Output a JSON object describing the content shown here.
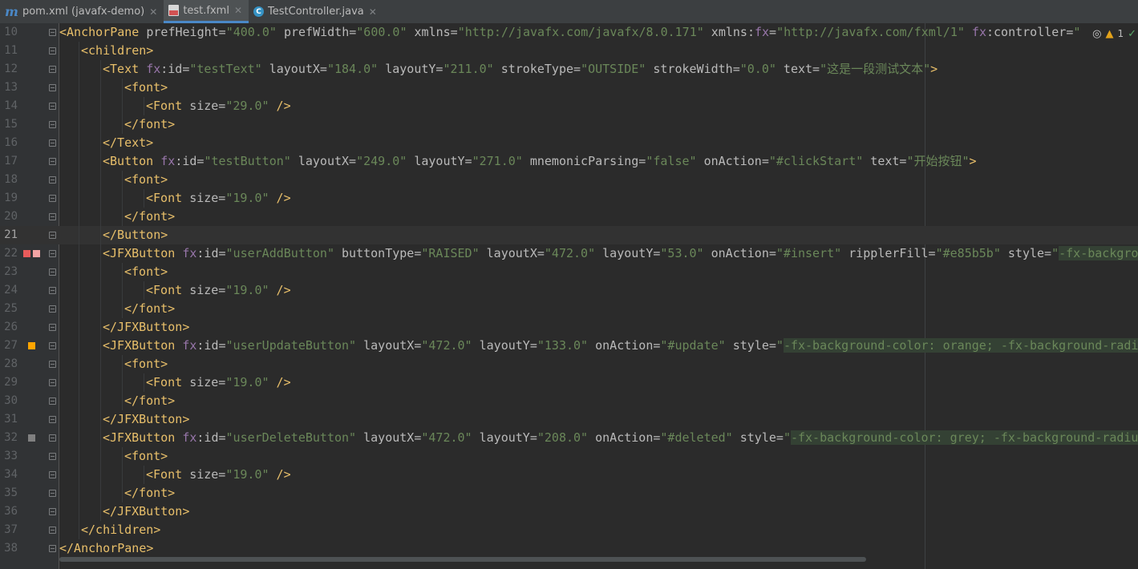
{
  "tabs": [
    {
      "label": "pom.xml (javafx-demo)",
      "icon": "maven-icon",
      "active": false
    },
    {
      "label": "test.fxml",
      "icon": "fxml-file-icon",
      "active": true
    },
    {
      "label": "TestController.java",
      "icon": "java-class-icon",
      "active": false
    }
  ],
  "close_glyph": "✕",
  "inspections": {
    "warning_count": "1"
  },
  "current_line": "21",
  "swatch_colors": {
    "line22": [
      "#e85b5b",
      "#f4a4a4"
    ],
    "line27": "#ffa500",
    "line32": "#808080"
  },
  "lines": [
    {
      "num": "10",
      "indent": 0,
      "tokens": [
        [
          "tag",
          "<AnchorPane "
        ],
        [
          "attr",
          "prefHeight="
        ],
        [
          "val",
          "\"400.0\""
        ],
        [
          "attr",
          " prefWidth="
        ],
        [
          "val",
          "\"600.0\""
        ],
        [
          "attr",
          " xmlns="
        ],
        [
          "val",
          "\"http://javafx.com/javafx/8.0.171\""
        ],
        [
          "attr",
          " xmlns:"
        ],
        [
          "ns",
          "fx"
        ],
        [
          "attr",
          "="
        ],
        [
          "val",
          "\"http://javafx.com/fxml/1\""
        ],
        [
          "ns",
          " fx"
        ],
        [
          "attr",
          ":controller="
        ],
        [
          "val",
          "\""
        ]
      ]
    },
    {
      "num": "11",
      "indent": 1,
      "tokens": [
        [
          "tag",
          "<children>"
        ]
      ]
    },
    {
      "num": "12",
      "indent": 2,
      "tokens": [
        [
          "tag",
          "<Text "
        ],
        [
          "ns",
          "fx"
        ],
        [
          "attr",
          ":id="
        ],
        [
          "val",
          "\"testText\""
        ],
        [
          "attr",
          " layoutX="
        ],
        [
          "val",
          "\"184.0\""
        ],
        [
          "attr",
          " layoutY="
        ],
        [
          "val",
          "\"211.0\""
        ],
        [
          "attr",
          " strokeType="
        ],
        [
          "val",
          "\"OUTSIDE\""
        ],
        [
          "attr",
          " strokeWidth="
        ],
        [
          "val",
          "\"0.0\""
        ],
        [
          "attr",
          " text="
        ],
        [
          "val",
          "\"这是一段测试文本\""
        ],
        [
          "tag",
          ">"
        ]
      ]
    },
    {
      "num": "13",
      "indent": 3,
      "tokens": [
        [
          "tag",
          "<font>"
        ]
      ]
    },
    {
      "num": "14",
      "indent": 4,
      "tokens": [
        [
          "tag",
          "<Font "
        ],
        [
          "attr",
          "size="
        ],
        [
          "val",
          "\"29.0\""
        ],
        [
          "tag",
          " />"
        ]
      ]
    },
    {
      "num": "15",
      "indent": 3,
      "tokens": [
        [
          "tag",
          "</font>"
        ]
      ]
    },
    {
      "num": "16",
      "indent": 2,
      "tokens": [
        [
          "tag",
          "</Text>"
        ]
      ]
    },
    {
      "num": "17",
      "indent": 2,
      "tokens": [
        [
          "tag",
          "<Button "
        ],
        [
          "ns",
          "fx"
        ],
        [
          "attr",
          ":id="
        ],
        [
          "val",
          "\"testButton\""
        ],
        [
          "attr",
          " layoutX="
        ],
        [
          "val",
          "\"249.0\""
        ],
        [
          "attr",
          " layoutY="
        ],
        [
          "val",
          "\"271.0\""
        ],
        [
          "attr",
          " mnemonicParsing="
        ],
        [
          "val",
          "\"false\""
        ],
        [
          "attr",
          " onAction="
        ],
        [
          "val",
          "\"#clickStart\""
        ],
        [
          "attr",
          " text="
        ],
        [
          "val",
          "\"开始按钮\""
        ],
        [
          "tag",
          ">"
        ]
      ]
    },
    {
      "num": "18",
      "indent": 3,
      "tokens": [
        [
          "tag",
          "<font>"
        ]
      ]
    },
    {
      "num": "19",
      "indent": 4,
      "tokens": [
        [
          "tag",
          "<Font "
        ],
        [
          "attr",
          "size="
        ],
        [
          "val",
          "\"19.0\""
        ],
        [
          "tag",
          " />"
        ]
      ]
    },
    {
      "num": "20",
      "indent": 3,
      "tokens": [
        [
          "tag",
          "</font>"
        ]
      ]
    },
    {
      "num": "21",
      "indent": 2,
      "tokens": [
        [
          "tag",
          "</Button>"
        ]
      ]
    },
    {
      "num": "22",
      "indent": 2,
      "tokens": [
        [
          "tag",
          "<JFXButton "
        ],
        [
          "ns",
          "fx"
        ],
        [
          "attr",
          ":id="
        ],
        [
          "val",
          "\"userAddButton\""
        ],
        [
          "attr",
          " buttonType="
        ],
        [
          "val",
          "\"RAISED\""
        ],
        [
          "attr",
          " layoutX="
        ],
        [
          "val",
          "\"472.0\""
        ],
        [
          "attr",
          " layoutY="
        ],
        [
          "val",
          "\"53.0\""
        ],
        [
          "attr",
          " onAction="
        ],
        [
          "val",
          "\"#insert\""
        ],
        [
          "attr",
          " ripplerFill="
        ],
        [
          "val",
          "\"#e85b5b\""
        ],
        [
          "attr",
          " style="
        ],
        [
          "val",
          "\""
        ],
        [
          "css",
          "-fx-backgrou"
        ]
      ]
    },
    {
      "num": "23",
      "indent": 3,
      "tokens": [
        [
          "tag",
          "<font>"
        ]
      ]
    },
    {
      "num": "24",
      "indent": 4,
      "tokens": [
        [
          "tag",
          "<Font "
        ],
        [
          "attr",
          "size="
        ],
        [
          "val",
          "\"19.0\""
        ],
        [
          "tag",
          " />"
        ]
      ]
    },
    {
      "num": "25",
      "indent": 3,
      "tokens": [
        [
          "tag",
          "</font>"
        ]
      ]
    },
    {
      "num": "26",
      "indent": 2,
      "tokens": [
        [
          "tag",
          "</JFXButton>"
        ]
      ]
    },
    {
      "num": "27",
      "indent": 2,
      "tokens": [
        [
          "tag",
          "<JFXButton "
        ],
        [
          "ns",
          "fx"
        ],
        [
          "attr",
          ":id="
        ],
        [
          "val",
          "\"userUpdateButton\""
        ],
        [
          "attr",
          " layoutX="
        ],
        [
          "val",
          "\"472.0\""
        ],
        [
          "attr",
          " layoutY="
        ],
        [
          "val",
          "\"133.0\""
        ],
        [
          "attr",
          " onAction="
        ],
        [
          "val",
          "\"#update\""
        ],
        [
          "attr",
          " style="
        ],
        [
          "val",
          "\""
        ],
        [
          "css",
          "-fx-background-color: orange; -fx-background-radiu"
        ]
      ]
    },
    {
      "num": "28",
      "indent": 3,
      "tokens": [
        [
          "tag",
          "<font>"
        ]
      ]
    },
    {
      "num": "29",
      "indent": 4,
      "tokens": [
        [
          "tag",
          "<Font "
        ],
        [
          "attr",
          "size="
        ],
        [
          "val",
          "\"19.0\""
        ],
        [
          "tag",
          " />"
        ]
      ]
    },
    {
      "num": "30",
      "indent": 3,
      "tokens": [
        [
          "tag",
          "</font>"
        ]
      ]
    },
    {
      "num": "31",
      "indent": 2,
      "tokens": [
        [
          "tag",
          "</JFXButton>"
        ]
      ]
    },
    {
      "num": "32",
      "indent": 2,
      "tokens": [
        [
          "tag",
          "<JFXButton "
        ],
        [
          "ns",
          "fx"
        ],
        [
          "attr",
          ":id="
        ],
        [
          "val",
          "\"userDeleteButton\""
        ],
        [
          "attr",
          " layoutX="
        ],
        [
          "val",
          "\"472.0\""
        ],
        [
          "attr",
          " layoutY="
        ],
        [
          "val",
          "\"208.0\""
        ],
        [
          "attr",
          " onAction="
        ],
        [
          "val",
          "\"#deleted\""
        ],
        [
          "attr",
          " style="
        ],
        [
          "val",
          "\""
        ],
        [
          "css",
          "-fx-background-color: grey; -fx-background-radius"
        ]
      ]
    },
    {
      "num": "33",
      "indent": 3,
      "tokens": [
        [
          "tag",
          "<font>"
        ]
      ]
    },
    {
      "num": "34",
      "indent": 4,
      "tokens": [
        [
          "tag",
          "<Font "
        ],
        [
          "attr",
          "size="
        ],
        [
          "val",
          "\"19.0\""
        ],
        [
          "tag",
          " />"
        ]
      ]
    },
    {
      "num": "35",
      "indent": 3,
      "tokens": [
        [
          "tag",
          "</font>"
        ]
      ]
    },
    {
      "num": "36",
      "indent": 2,
      "tokens": [
        [
          "tag",
          "</JFXButton>"
        ]
      ]
    },
    {
      "num": "37",
      "indent": 1,
      "tokens": [
        [
          "tag",
          "</children>"
        ]
      ]
    },
    {
      "num": "38",
      "indent": 0,
      "tokens": [
        [
          "tag",
          "</AnchorPane>"
        ]
      ]
    }
  ]
}
